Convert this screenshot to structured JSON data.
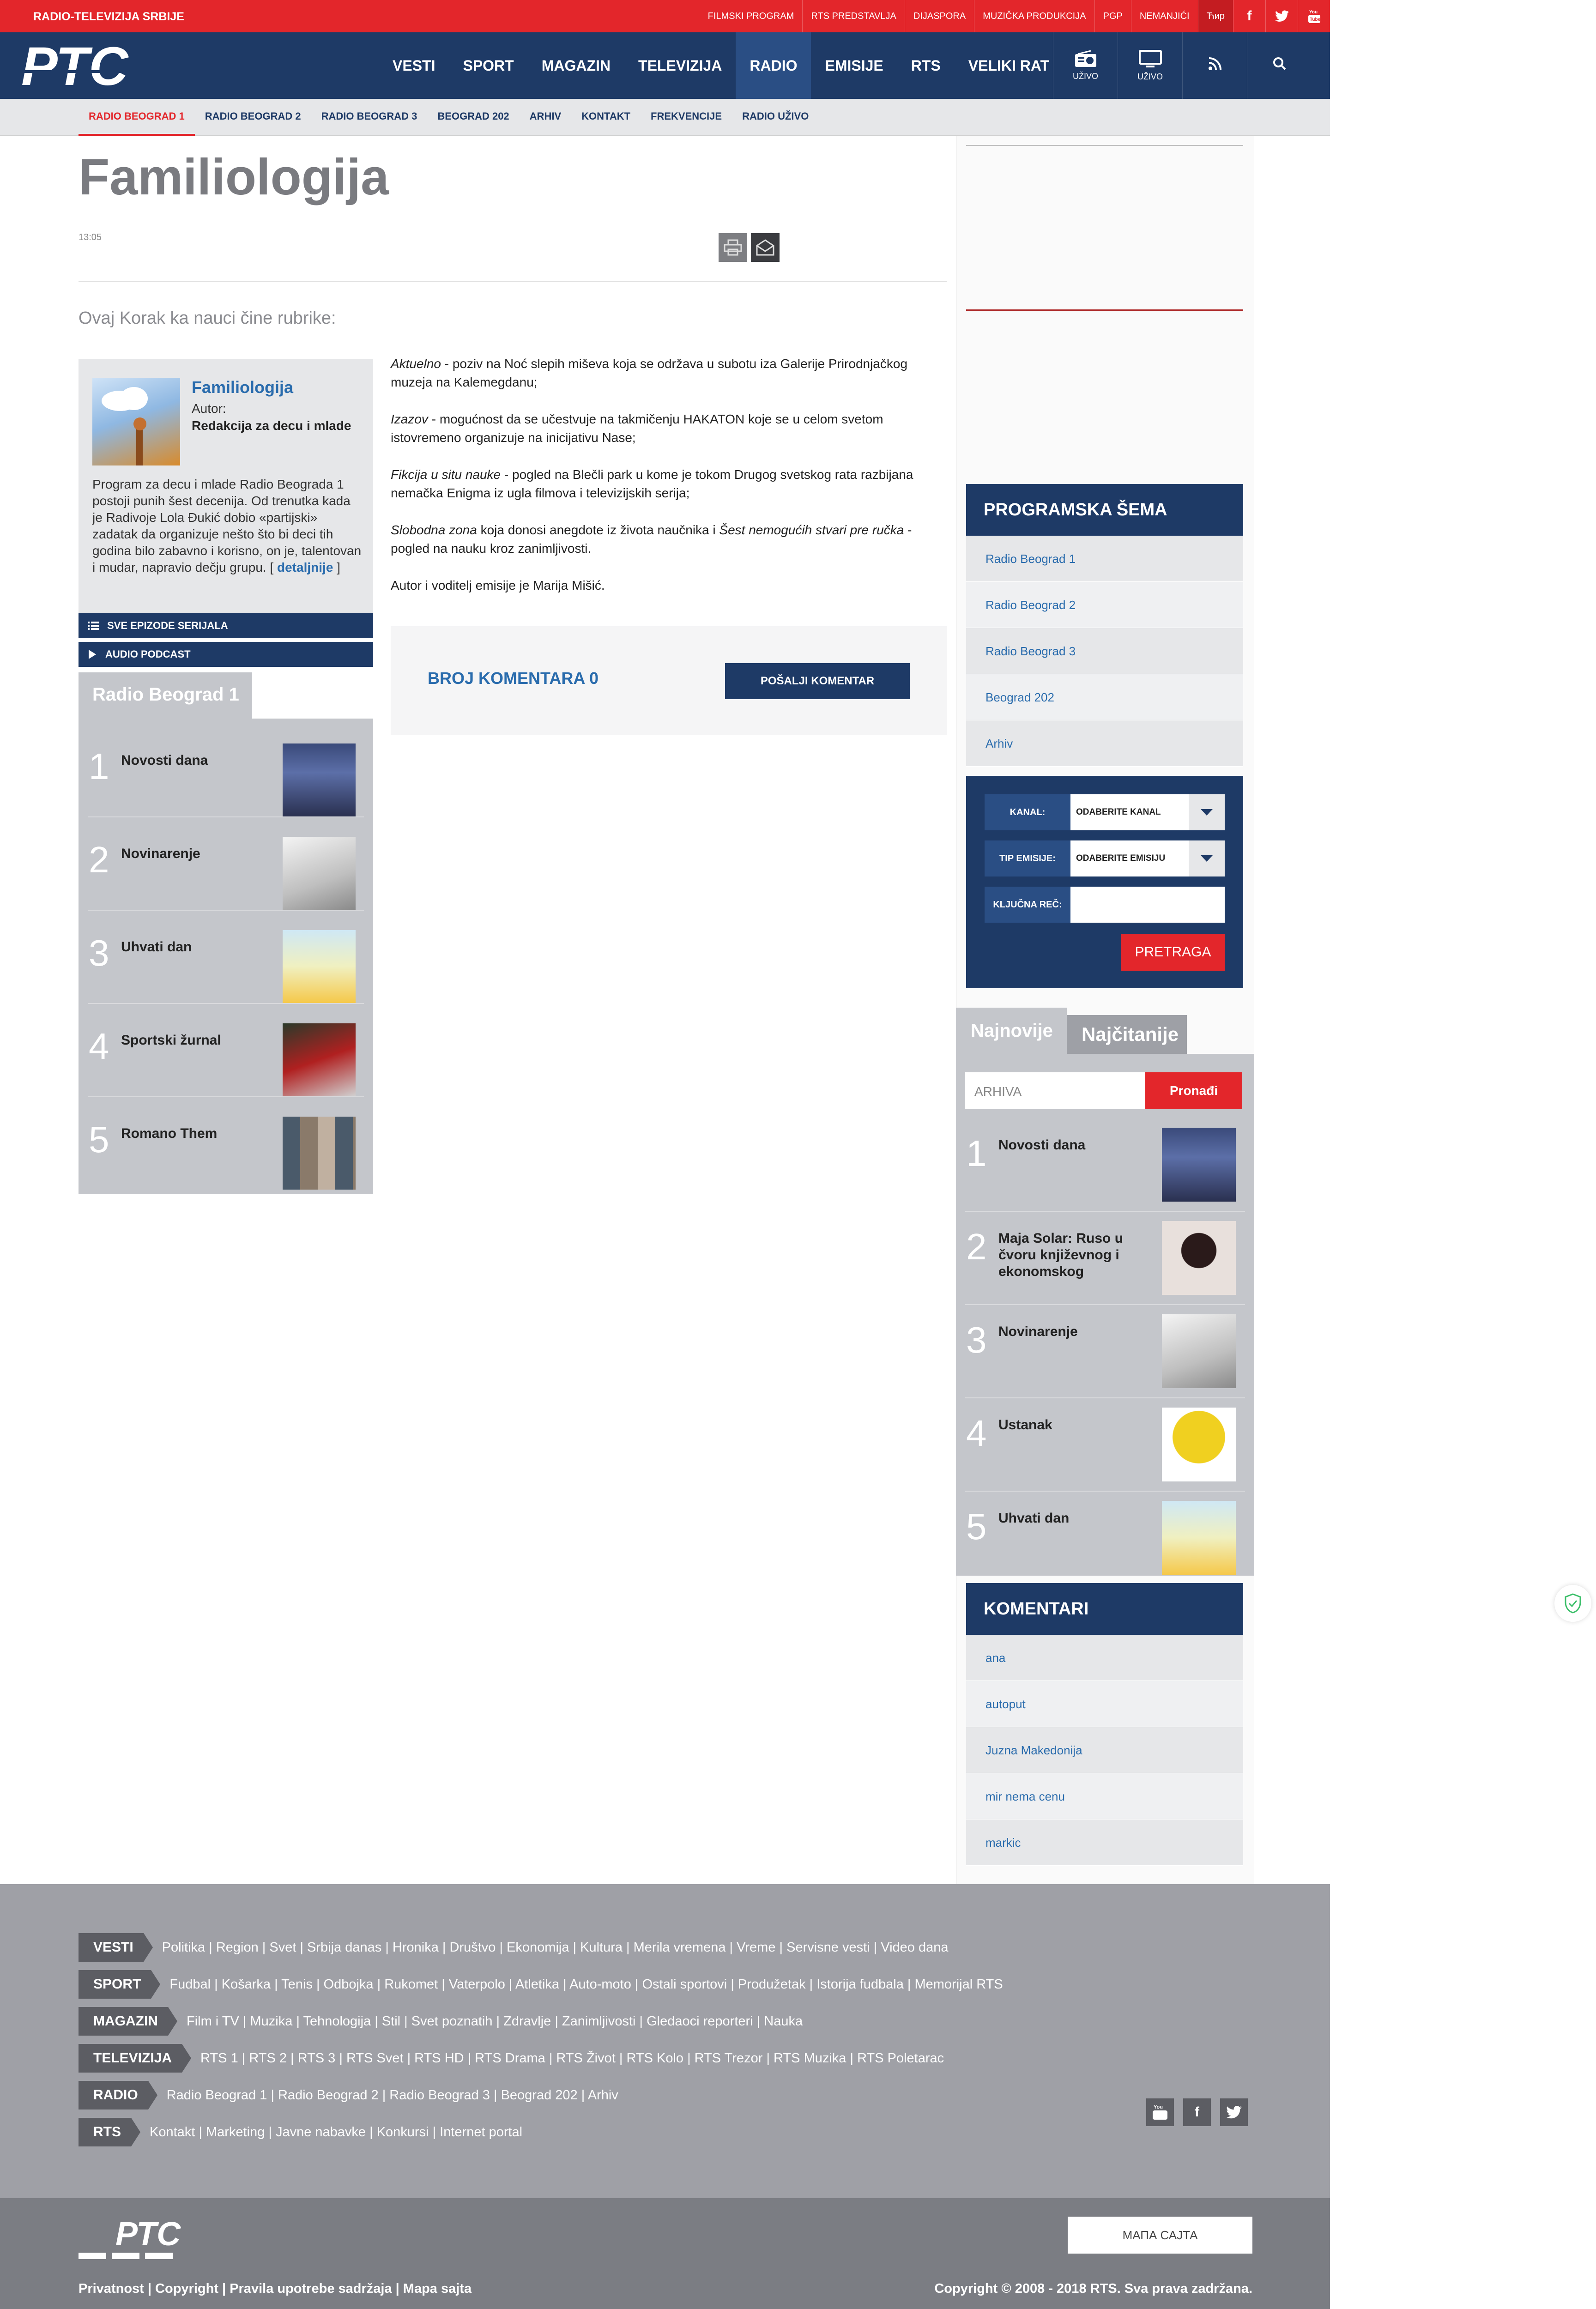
{
  "topbar": {
    "brand": "RADIO-TELEVIZIJA SRBIJE",
    "links": [
      "FILMSKI PROGRAM",
      "RTS PREDSTAVLJA",
      "DIJASPORA",
      "MUZIČKA PRODUKCIJA",
      "PGP",
      "NEMANJIĆI"
    ],
    "tvr": "Ћир"
  },
  "nav": {
    "items": [
      "VESTI",
      "SPORT",
      "MAGAZIN",
      "TELEVIZIJA",
      "RADIO",
      "EMISIJE",
      "RTS",
      "VELIKI RAT"
    ],
    "uzivo1": "UŽIVO",
    "uzivo2": "UŽIVO"
  },
  "subnav": [
    "RADIO BEOGRAD 1",
    "RADIO BEOGRAD 2",
    "RADIO BEOGRAD 3",
    "BEOGRAD 202",
    "ARHIV",
    "KONTAKT",
    "FREKVENCIJE",
    "RADIO UŽIVO"
  ],
  "article": {
    "title": "Familiologija",
    "time": "13:05",
    "intro": "Ovaj Korak ka nauci čine rubrike:",
    "p1_em": "Aktuelno",
    "p1": " - poziv na Noć slepih miševa koja se održava u subotu iza Galerije Prirodnjačkog muzeja na Kalemegdanu;",
    "p2_em": "Izazov",
    "p2": " - mogućnost da se učestvuje na takmičenju HAKATON koje se u celom svetom istovremeno organizuje na inicijativu Nase;",
    "p3_em": "Fikcija u situ nauke",
    "p3": " - pogled na Blečli park u kome je tokom Drugog svetskog rata razbijana nemačka Enigma iz ugla filmova i televizijskih serija;",
    "p4_em": "Slobodna zona",
    "p4a": " koja donosi anegdote iz života naučnika i ",
    "p4_em2": "Šest nemogućih stvari pre ručka",
    "p4b": " - pogled na nauku kroz zanimljivosti.",
    "p5": "Autor i voditelj emisije je Marija Mišić."
  },
  "show": {
    "name": "Familiologija",
    "author_label": "Autor:",
    "author": "Redakcija za decu i mlade",
    "desc": "Program za decu i mlade Radio Beograda 1 postoji punih šest decenija. Od trenutka kada je Radivoje Lola Đukić dobio «partijski» zadatak da organizuje nešto što bi deci tih godina bilo zabavno i korisno, on je, talentovan i mudar, napravio dečju grupu.",
    "more": "detaljnije",
    "btn1": "SVE EPIZODE SERIJALA",
    "btn2": "AUDIO PODCAST"
  },
  "rb1": {
    "tab": "Radio Beograd 1",
    "items": [
      {
        "n": "1",
        "label": "Novosti dana"
      },
      {
        "n": "2",
        "label": "Novinarenje"
      },
      {
        "n": "3",
        "label": "Uhvati dan"
      },
      {
        "n": "4",
        "label": "Sportski žurnal"
      },
      {
        "n": "5",
        "label": "Romano Them"
      }
    ]
  },
  "comments": {
    "count_label": "BROJ KOMENTARA 0",
    "send": "POŠALJI KOMENTAR"
  },
  "schedule": {
    "title": "PROGRAMSKA ŠEMA",
    "items": [
      "Radio Beograd 1",
      "Radio Beograd 2",
      "Radio Beograd 3",
      "Beograd 202",
      "Arhiv"
    ]
  },
  "search": {
    "kanal_label": "KANAL:",
    "kanal_value": "ODABERITE KANAL",
    "tip_label": "TIP EMISIJE:",
    "tip_value": "ODABERITE EMISIJU",
    "kljucna_label": "KLJUČNA REČ:",
    "button": "PRETRAGA"
  },
  "latest": {
    "tab1": "Najnovije",
    "tab2": "Najčitanije",
    "archive_placeholder": "ARHIVA",
    "find": "Pronađi",
    "items": [
      {
        "n": "1",
        "label": "Novosti dana"
      },
      {
        "n": "2",
        "label": "Maja Solar: Ruso u čvoru književnog i ekonomskog"
      },
      {
        "n": "3",
        "label": "Novinarenje"
      },
      {
        "n": "4",
        "label": "Ustanak"
      },
      {
        "n": "5",
        "label": "Uhvati dan"
      }
    ]
  },
  "komentari": {
    "title": "KOMENTARI",
    "items": [
      "ana",
      "autoput",
      "Juzna Makedonija",
      "mir nema cenu",
      "markic"
    ]
  },
  "footer": {
    "rows": [
      {
        "tag": "VESTI",
        "links": "Politika  |  Region  |  Svet  |  Srbija danas  |  Hronika  |  Društvo  |  Ekonomija  |  Kultura  |  Merila vremena  |  Vreme  |  Servisne vesti  |  Video dana"
      },
      {
        "tag": "SPORT",
        "links": "Fudbal  |  Košarka  |  Tenis  |  Odbojka  |  Rukomet  |  Vaterpolo  |  Atletika  |  Auto-moto  |  Ostali sportovi  |  Produžetak  |  Istorija fudbala  |  Memorijal RTS"
      },
      {
        "tag": "MAGAZIN",
        "links": "Film i TV  |  Muzika  |  Tehnologija  |  Stil  |  Svet poznatih  |  Zdravlje  |  Zanimljivosti  |  Gledaoci reporteri  |  Nauka"
      },
      {
        "tag": "TELEVIZIJA",
        "links": "RTS 1  |  RTS 2  |  RTS 3  |  RTS Svet  |  RTS HD  |  RTS Drama  |  RTS Život  |  RTS Kolo  |  RTS Trezor  |  RTS Muzika  |  RTS Poletarac"
      },
      {
        "tag": "RADIO",
        "links": "Radio Beograd 1  |  Radio Beograd 2  |  Radio Beograd 3  |  Beograd 202  |  Arhiv"
      },
      {
        "tag": "RTS",
        "links": "Kontakt  |  Marketing  |  Javne nabavke  |  Konkursi  |  Internet portal"
      }
    ],
    "mapa": "МАПА САЈТА",
    "bottom_left": "Privatnost | Copyright | Pravila upotrebe sadržaja | Mapa sajta",
    "bottom_right": "Copyright © 2008 - 2018 RTS. Sva prava zadržana."
  },
  "logo_text": "РТС",
  "colors": {
    "red": "#e3262b",
    "navy": "#1e3a66",
    "gray": "#c4c6cb",
    "link": "#2a6cad"
  }
}
